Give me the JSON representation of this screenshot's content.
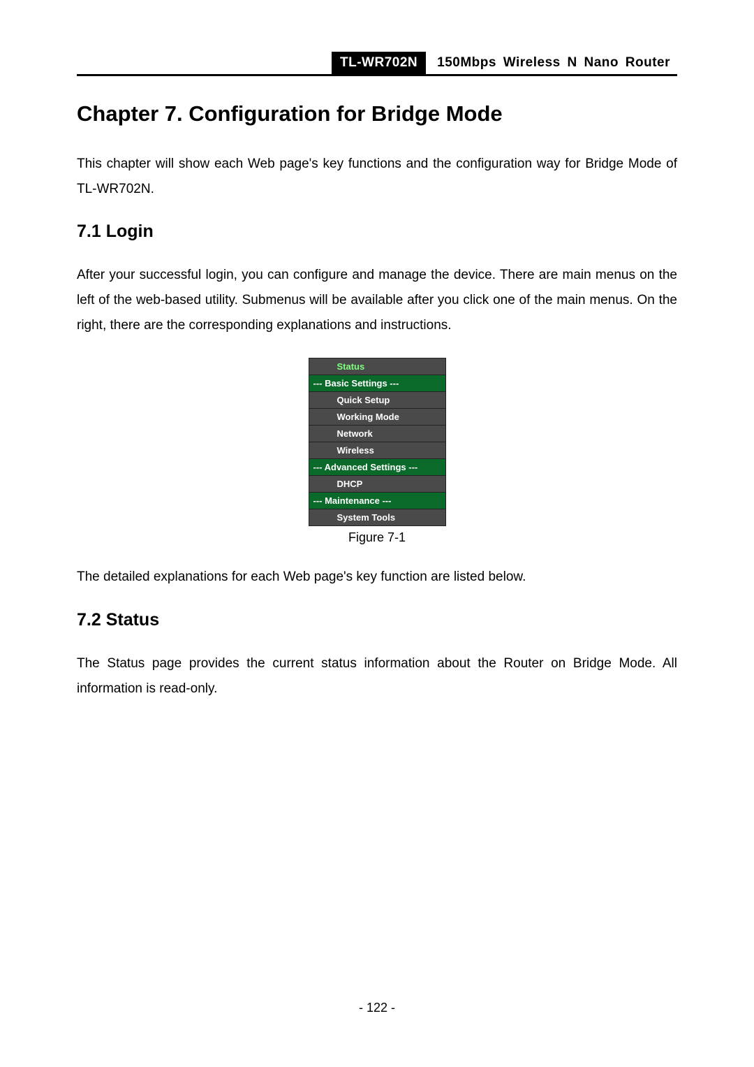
{
  "header": {
    "model": "TL-WR702N",
    "product_title": "150Mbps Wireless N Nano Router"
  },
  "chapter": {
    "title": "Chapter 7.   Configuration for Bridge Mode",
    "intro": "This chapter will show each Web page's key functions and the configuration way for Bridge Mode of TL-WR702N."
  },
  "section_login": {
    "title": "7.1  Login",
    "para": "After your successful login, you can configure and manage the device. There are main menus on the left of the web-based utility. Submenus will be available after you click one of the main menus. On the right, there are the corresponding explanations and instructions."
  },
  "nav_menu": {
    "status": "Status",
    "basic_settings": "--- Basic Settings ---",
    "quick_setup": "Quick Setup",
    "working_mode": "Working Mode",
    "network": "Network",
    "wireless": "Wireless",
    "advanced_settings": "--- Advanced Settings ---",
    "dhcp": "DHCP",
    "maintenance": "--- Maintenance ---",
    "system_tools": "System Tools"
  },
  "figure_caption": "Figure 7-1",
  "section_login_footer": "The detailed explanations for each Web page's key function are listed below.",
  "section_status": {
    "title": "7.2  Status",
    "para": "The Status page provides the current status information about the Router on Bridge Mode. All information is read-only."
  },
  "page_number": "- 122 -"
}
